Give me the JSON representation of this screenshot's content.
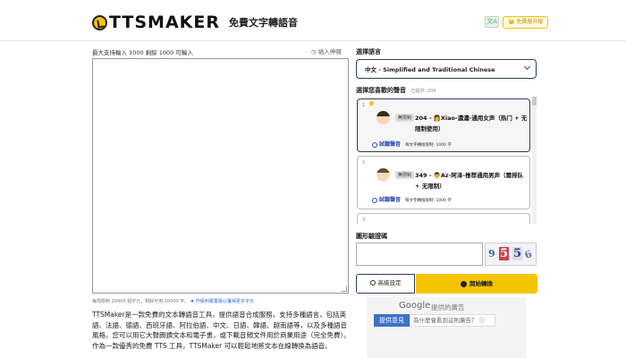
{
  "header": {
    "logo": "TTSMAKER",
    "subtitle": "免費文字轉語音",
    "lang_button": "",
    "cta_button": "👑 免費版升級"
  },
  "editor": {
    "limit_label": "最大支持輸入 1000 剩餘 1000 可輸入",
    "help_label": "插入停頓",
    "footer_note": "每周限制 20000 個字元，剩餘可用 20000 字。",
    "footer_link": "升級到專業版以獲得更多字元",
    "description": "TTSMaker是一款免費的文本轉語音工具，提供語音合成服務，支持多種語言，包括英語、法語、德語、西班牙語、阿拉伯語、中文、日語、韓語、越南語等，以及多種語音風格。您可以用它大聲朗讀文本和電子書，或下載音頻文件用於商業用途（完全免費）。作為一款優秀的免費 TTS 工具，TTSMaker 可以輕鬆地將文本在線轉換為語音。"
  },
  "language": {
    "title": "選擇語言",
    "selected": "中文 - Simplified and Traditional Chinese"
  },
  "voices": {
    "title": "選擇您喜歡的聲音",
    "count_label": "已提供: 204",
    "items": [
      {
        "index": "1",
        "tag": "無限制",
        "name": "204 - 👩Xiao-濃濃-通用女声（热门 + 无限制使用）",
        "listen": "試聽聲音",
        "limit": "每文字轉換限制: 1000 字",
        "selected": true
      },
      {
        "index": "2",
        "tag": "無限制",
        "name": "349 - 👨Az-阿泽-推荐通用男声（需排队 + 无限制）",
        "listen": "試聽聲音",
        "limit": "每文字轉換限制: 1000 字",
        "selected": false
      },
      {
        "index": "3",
        "tag": "",
        "name": "",
        "listen": "",
        "limit": "",
        "selected": false
      }
    ]
  },
  "captcha": {
    "title": "圖形驗證碼",
    "chars": [
      "9",
      "5",
      "5",
      "6"
    ]
  },
  "actions": {
    "advanced": "高級設定",
    "convert": "開始轉換"
  },
  "ad": {
    "google": "Google",
    "provided": "提供的廣告",
    "feedback": "提供意見",
    "why": "為什麼會看到這則廣告？ ⓘ"
  }
}
